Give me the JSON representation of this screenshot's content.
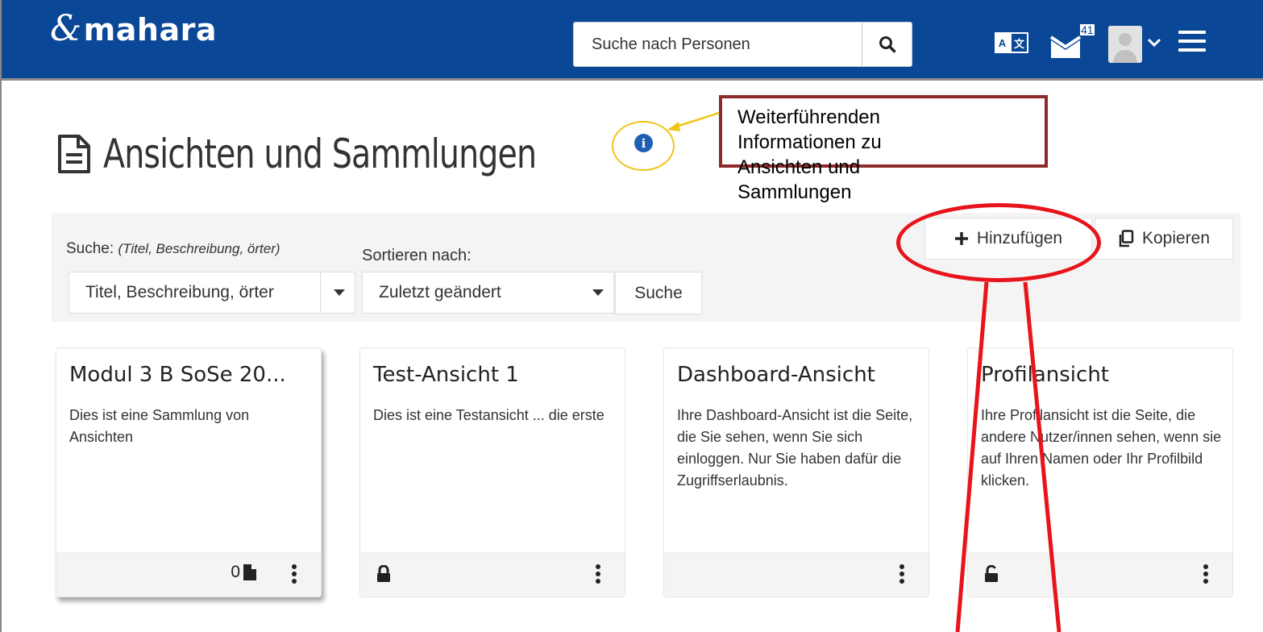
{
  "header": {
    "logo_text": "mahara",
    "logo_amp": "&",
    "search_placeholder": "Suche nach Personen",
    "lang_a": "A",
    "lang_b": "文",
    "mail_count": "41",
    "bg_color": "#0a4796"
  },
  "page": {
    "title": "Ansichten und Sammlungen",
    "info_symbol": "i"
  },
  "annotation": {
    "callout_text": "Weiterführenden\nInformationen zu\nAnsichten und\nSammlungen",
    "callout_border": "#8e2a2a",
    "highlight_color": "#e8141b",
    "arrow_color": "#f0c419"
  },
  "filters": {
    "search_label": "Suche:",
    "search_hint": "(Titel, Beschreibung, örter)",
    "search_select_value": "Titel, Beschreibung, örter",
    "sort_label": "Sortieren nach:",
    "sort_select_value": "Zuletzt geändert",
    "search_button": "Suche"
  },
  "actions": {
    "add_label": "Hinzufügen",
    "copy_label": "Kopieren"
  },
  "cards": [
    {
      "title": "Modul 3 B SoSe 20...",
      "description": "Dies ist eine Sammlung von Ansichten",
      "count": "0",
      "footer_icon": "file-icon"
    },
    {
      "title": "Test-Ansicht 1",
      "description": "Dies ist eine Testansicht ... die erste",
      "footer_icon": "lock-icon"
    },
    {
      "title": "Dashboard-Ansicht",
      "description": "Ihre Dashboard-Ansicht ist die Seite, die Sie sehen, wenn Sie sich einloggen. Nur Sie haben dafür die Zugriffserlaubnis.",
      "footer_icon": "none"
    },
    {
      "title": "Profilansicht",
      "description": "Ihre Profilansicht ist die Seite, die andere Nutzer/innen sehen, wenn sie auf Ihren Namen oder Ihr Profilbild klicken.",
      "footer_icon": "unlock-icon"
    }
  ]
}
